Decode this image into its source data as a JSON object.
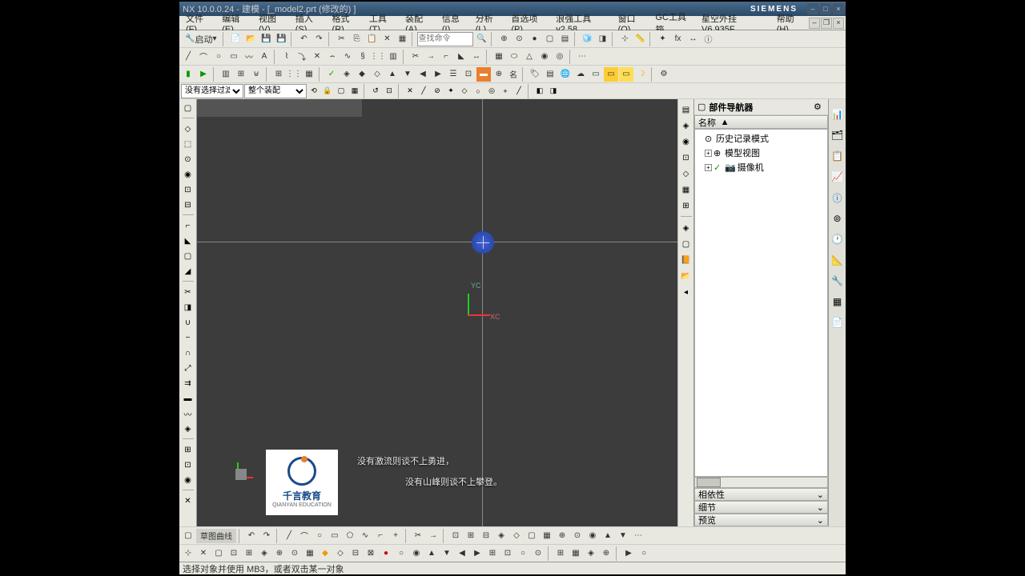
{
  "titlebar": {
    "app": "NX 10.0.0.24",
    "doc": "建模 - [_model2.prt  (修改的) ]",
    "brand": "SIEMENS"
  },
  "menu": {
    "file": "文件(F)",
    "edit": "编辑(E)",
    "view": "视图(V)",
    "insert": "插入(S)",
    "format": "格式(R)",
    "tools": "工具(T)",
    "assemblies": "装配(A)",
    "information": "信息(I)",
    "analysis": "分析(L)",
    "preferences": "首选项(P)",
    "wave_tool": "浪强工具v2.58",
    "window": "窗口(O)",
    "gc_toolbox": "GC工具箱",
    "star_plugin": "星空外挂  V6.935F",
    "help": "帮助(H)"
  },
  "toolbar1": {
    "start": "启动",
    "search_placeholder": "查找命令"
  },
  "selection_bar": {
    "filter_label": "没有选择过滤器",
    "scope": "整个装配"
  },
  "navigator": {
    "title": "部件导航器",
    "col_name": "名称",
    "sort_indicator": "▲",
    "nodes": {
      "history": "历史记录模式",
      "model_views": "模型视图",
      "cameras": "摄像机"
    }
  },
  "nav_sections": {
    "dependency": "相依性",
    "details": "细节",
    "preview": "预览"
  },
  "viewport": {
    "yc": "YC",
    "xc": "XC",
    "watermark_cn": "千言教育",
    "watermark_en": "QIANYAN EDUCATION",
    "subtitle1": "没有激流则谈不上勇进，",
    "subtitle2": "没有山峰则谈不上攀登。"
  },
  "statusbar": {
    "msg": "选择对象并使用 MB3，或者双击某一对象"
  },
  "bottom_tab": "草图曲线"
}
